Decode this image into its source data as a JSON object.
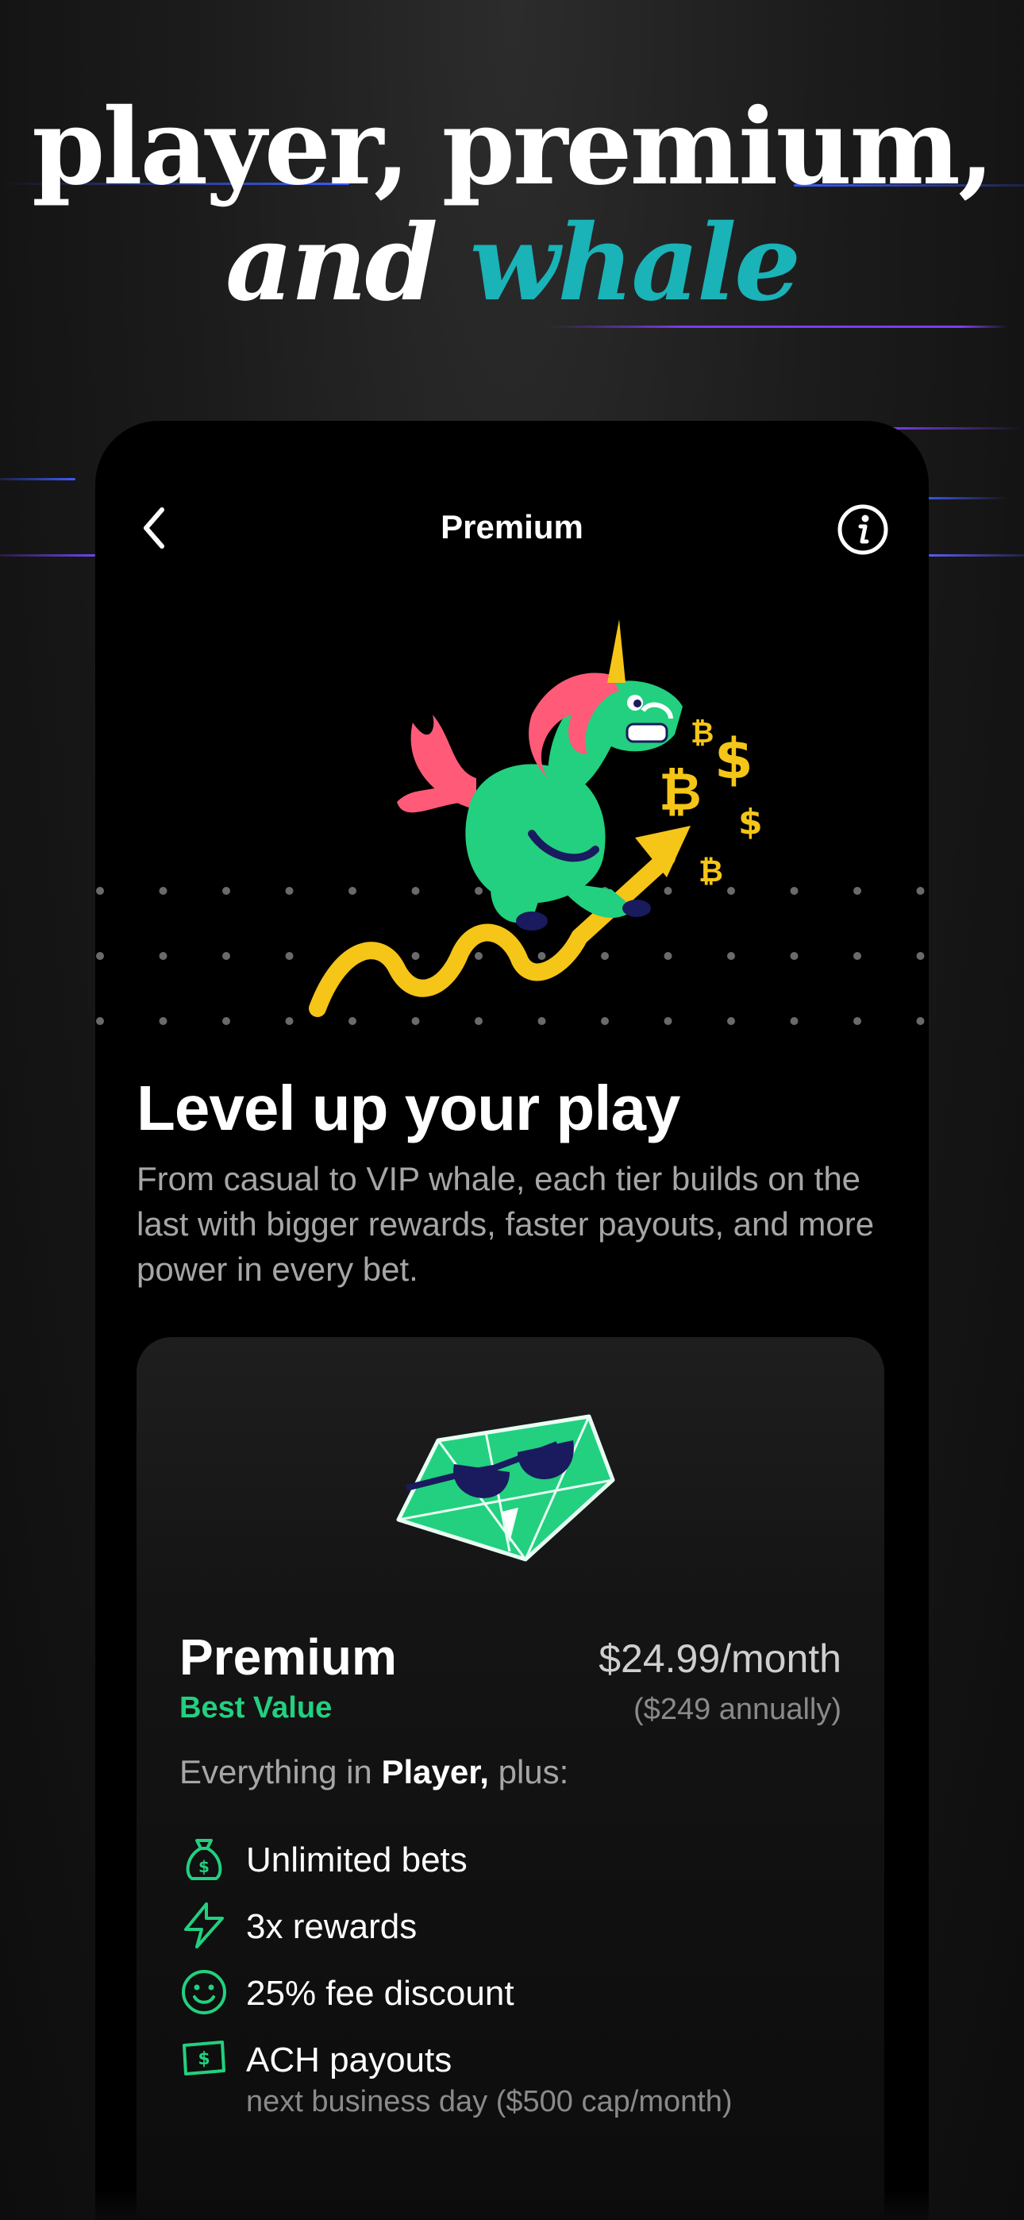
{
  "headline": {
    "line1": "player, premium,",
    "line2_start": "and",
    "line2_accent": "whale"
  },
  "colors": {
    "accent_teal": "#19b3b8",
    "accent_green": "#22d07f",
    "streak_purple": "#7b3cf0",
    "streak_blue": "#3b5bff"
  },
  "screen": {
    "title": "Premium",
    "back_icon": "chevron-left-icon",
    "info_icon": "info-icon"
  },
  "intro": {
    "heading": "Level up your play",
    "body": "From casual to VIP whale, each tier builds on the last with bigger rewards, faster payouts, and more power in every bet."
  },
  "tier": {
    "name": "Premium",
    "tag": "Best Value",
    "price": "$24.99/month",
    "annual": "($249 annually)",
    "includes_prefix": "Everything in ",
    "includes_tier": "Player,",
    "includes_suffix": " plus:",
    "features": [
      {
        "icon": "money-bag-icon",
        "label": "Unlimited bets"
      },
      {
        "icon": "lightning-icon",
        "label": "3x rewards"
      },
      {
        "icon": "smiley-icon",
        "label": "25% fee discount"
      },
      {
        "icon": "cash-icon",
        "label": "ACH payouts",
        "sub": "next business day ($500 cap/month)"
      }
    ]
  }
}
